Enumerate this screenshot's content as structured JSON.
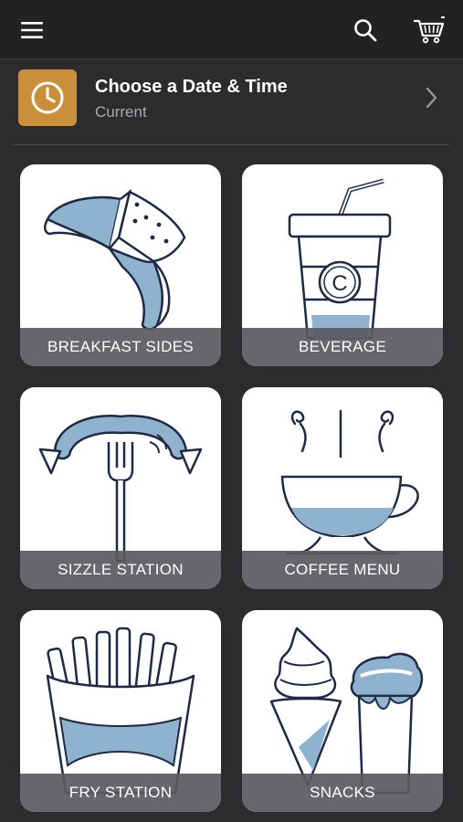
{
  "header": {
    "menu_icon": "hamburger-menu-icon",
    "search_icon": "search-icon",
    "cart_icon": "shopping-cart-icon"
  },
  "date_time": {
    "title": "Choose a Date & Time",
    "subtitle": "Current",
    "icon": "clock-icon",
    "accent_color": "#c98f3b"
  },
  "categories": [
    {
      "label": "BREAKFAST SIDES",
      "icon": "croissant-icon"
    },
    {
      "label": "BEVERAGE",
      "icon": "cup-with-straw-icon"
    },
    {
      "label": "SIZZLE STATION",
      "icon": "sausage-fork-icon"
    },
    {
      "label": "COFFEE MENU",
      "icon": "coffee-cup-icon"
    },
    {
      "label": "FRY STATION",
      "icon": "fries-icon"
    },
    {
      "label": "SNACKS",
      "icon": "ice-cream-icon"
    }
  ],
  "colors": {
    "background": "#2c2c2e",
    "icon_stroke": "#1e2a44",
    "icon_fill": "#8fb2cf"
  }
}
